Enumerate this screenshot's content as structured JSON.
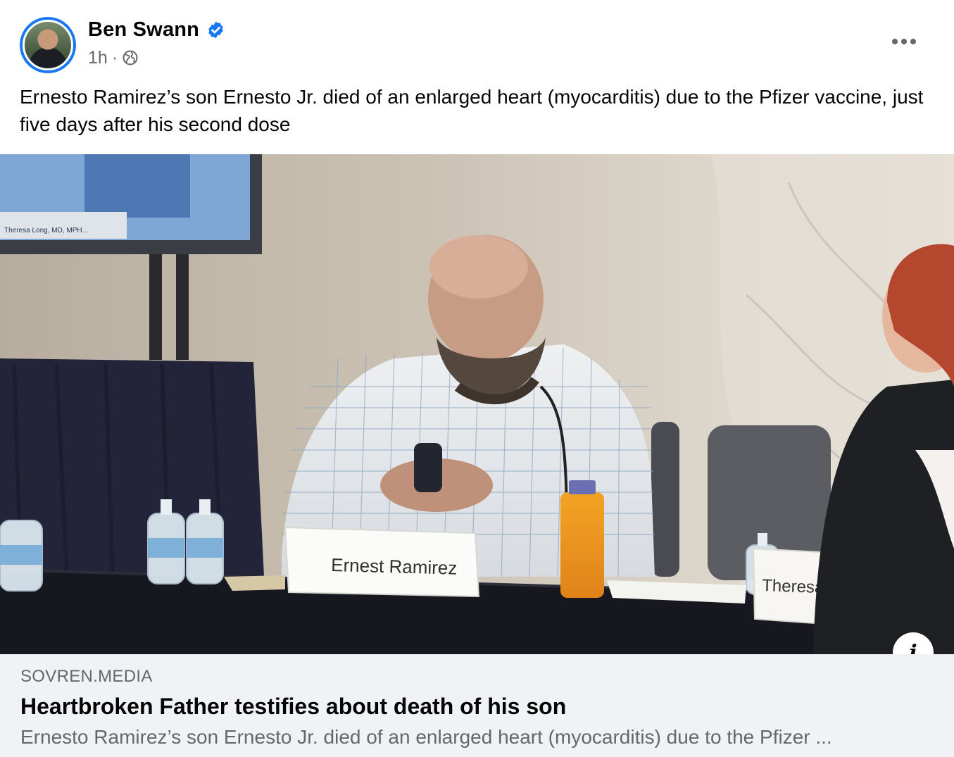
{
  "post": {
    "author": "Ben Swann",
    "verified": true,
    "time": "1h",
    "separator": "·",
    "audience_icon": "globe-icon",
    "text": "Ernesto Ramirez’s son Ernesto Jr. died of an enlarged heart (myocarditis) due to the Pfizer vaccine, just five days after his second dose"
  },
  "media": {
    "nameplate_left": "Ernest Ramirez",
    "nameplate_right": "Theresa Long, MD, MPH, FS",
    "monitor_caption": "Theresa Long, MD, MPH..."
  },
  "link_preview": {
    "domain": "SOVREN.MEDIA",
    "title": "Heartbroken Father testifies about death of his son",
    "description": "Ernesto Ramirez’s son Ernesto Jr. died of an enlarged heart (myocarditis) due to the Pfizer ..."
  },
  "icons": {
    "more": "more-horizontal-icon",
    "info": "info-icon",
    "verified": "verified-badge-icon"
  },
  "colors": {
    "accent": "#1877f2",
    "secondary_text": "#65676b",
    "footer_bg": "#f0f2f5"
  }
}
